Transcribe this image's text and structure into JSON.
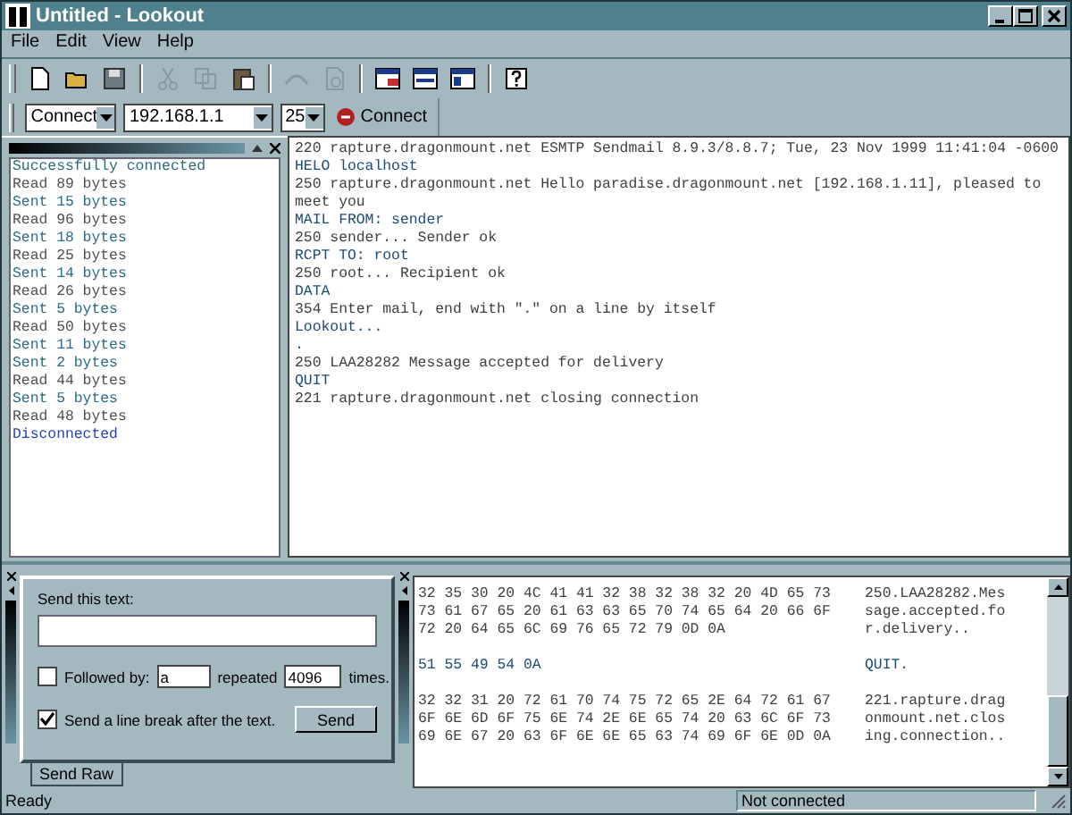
{
  "window": {
    "title": "Untitled - Lookout"
  },
  "menu": [
    "File",
    "Edit",
    "View",
    "Help"
  ],
  "connect_bar": {
    "mode": "Connect",
    "host": "192.168.1.1",
    "port": "25",
    "button": "Connect"
  },
  "log": [
    {
      "kind": "status",
      "text": "Successfully connected"
    },
    {
      "kind": "read",
      "text": "Read 89 bytes"
    },
    {
      "kind": "sent",
      "text": "Sent 15 bytes"
    },
    {
      "kind": "read",
      "text": "Read 96 bytes"
    },
    {
      "kind": "sent",
      "text": "Sent 18 bytes"
    },
    {
      "kind": "read",
      "text": "Read 25 bytes"
    },
    {
      "kind": "sent",
      "text": "Sent 14 bytes"
    },
    {
      "kind": "read",
      "text": "Read 26 bytes"
    },
    {
      "kind": "sent",
      "text": "Sent 5 bytes"
    },
    {
      "kind": "read",
      "text": "Read 50 bytes"
    },
    {
      "kind": "sent",
      "text": "Sent 11 bytes"
    },
    {
      "kind": "sent",
      "text": "Sent 2 bytes"
    },
    {
      "kind": "read",
      "text": "Read 44 bytes"
    },
    {
      "kind": "sent",
      "text": "Sent 5 bytes"
    },
    {
      "kind": "read",
      "text": "Read 48 bytes"
    },
    {
      "kind": "end",
      "text": "Disconnected"
    }
  ],
  "transcript": [
    {
      "kind": "server",
      "text": "220 rapture.dragonmount.net ESMTP Sendmail 8.9.3/8.8.7; Tue, 23 Nov 1999 11:41:04 -0600"
    },
    {
      "kind": "client",
      "text": "HELO localhost"
    },
    {
      "kind": "server",
      "text": "250 rapture.dragonmount.net Hello paradise.dragonmount.net [192.168.1.11], pleased to meet you"
    },
    {
      "kind": "client",
      "text": "MAIL FROM: sender"
    },
    {
      "kind": "server",
      "text": "250 sender... Sender ok"
    },
    {
      "kind": "client",
      "text": "RCPT TO: root"
    },
    {
      "kind": "server",
      "text": "250 root... Recipient ok"
    },
    {
      "kind": "client",
      "text": "DATA"
    },
    {
      "kind": "server",
      "text": "354 Enter mail, end with \".\" on a line by itself"
    },
    {
      "kind": "client",
      "text": "Lookout..."
    },
    {
      "kind": "client",
      "text": "."
    },
    {
      "kind": "server",
      "text": "250 LAA28282 Message accepted for delivery"
    },
    {
      "kind": "client",
      "text": "QUIT"
    },
    {
      "kind": "server",
      "text": "221 rapture.dragonmount.net closing connection"
    }
  ],
  "send_panel": {
    "label": "Send this text:",
    "followed_by": {
      "checked": false,
      "label": "Followed by:",
      "value": "a"
    },
    "repeated_label": "repeated",
    "count": "4096",
    "times_label": "times.",
    "line_break": {
      "checked": true,
      "label": "Send a line break after the text."
    },
    "send_button": "Send",
    "tab": "Send Raw"
  },
  "hex": [
    {
      "kind": "server",
      "rows": [
        {
          "hex": "32 35 30 20 4C 41 41 32 38 32 38 32 20 4D 65 73",
          "ascii": "250.LAA28282.Mes"
        },
        {
          "hex": "73 61 67 65 20 61 63 63 65 70 74 65 64 20 66 6F",
          "ascii": "sage.accepted.fo"
        },
        {
          "hex": "72 20 64 65 6C 69 76 65 72 79 0D 0A",
          "ascii": "r.delivery.."
        }
      ]
    },
    {
      "kind": "client",
      "rows": [
        {
          "hex": "51 55 49 54 0A",
          "ascii": "QUIT."
        }
      ]
    },
    {
      "kind": "server",
      "rows": [
        {
          "hex": "32 32 31 20 72 61 70 74 75 72 65 2E 64 72 61 67",
          "ascii": "221.rapture.drag"
        },
        {
          "hex": "6F 6E 6D 6F 75 6E 74 2E 6E 65 74 20 63 6C 6F 73",
          "ascii": "onmount.net.clos"
        },
        {
          "hex": "69 6E 67 20 63 6F 6E 6E 65 63 74 69 6F 6E 0D 0A",
          "ascii": "ing.connection.."
        }
      ]
    }
  ],
  "status_bar": [
    "Ready",
    "Not connected"
  ]
}
